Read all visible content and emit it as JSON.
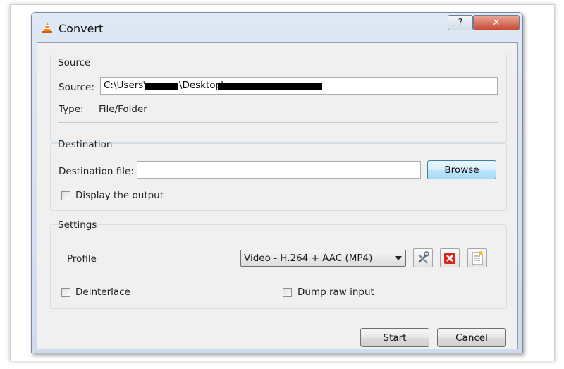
{
  "window": {
    "title": "Convert",
    "help_label": "?",
    "close_label": "✕"
  },
  "source": {
    "group_title": "Source",
    "source_label": "Source:",
    "source_prefix": "C:\\Users\\",
    "source_middle": "\\Desktop\\",
    "type_label": "Type:",
    "type_value": "File/Folder"
  },
  "destination": {
    "group_title": "Destination",
    "file_label": "Destination file:",
    "file_value": "",
    "browse_label": "Browse",
    "display_output_label": "Display the output",
    "display_output_checked": false
  },
  "settings": {
    "group_title": "Settings",
    "profile_label": "Profile",
    "profile_selected": "Video - H.264 + AAC (MP4)",
    "deinterlace_label": "Deinterlace",
    "deinterlace_checked": false,
    "dump_raw_label": "Dump raw input",
    "dump_raw_checked": false,
    "icons": [
      "edit-profile-icon",
      "delete-profile-icon",
      "new-profile-icon"
    ]
  },
  "footer": {
    "start_label": "Start",
    "cancel_label": "Cancel"
  }
}
